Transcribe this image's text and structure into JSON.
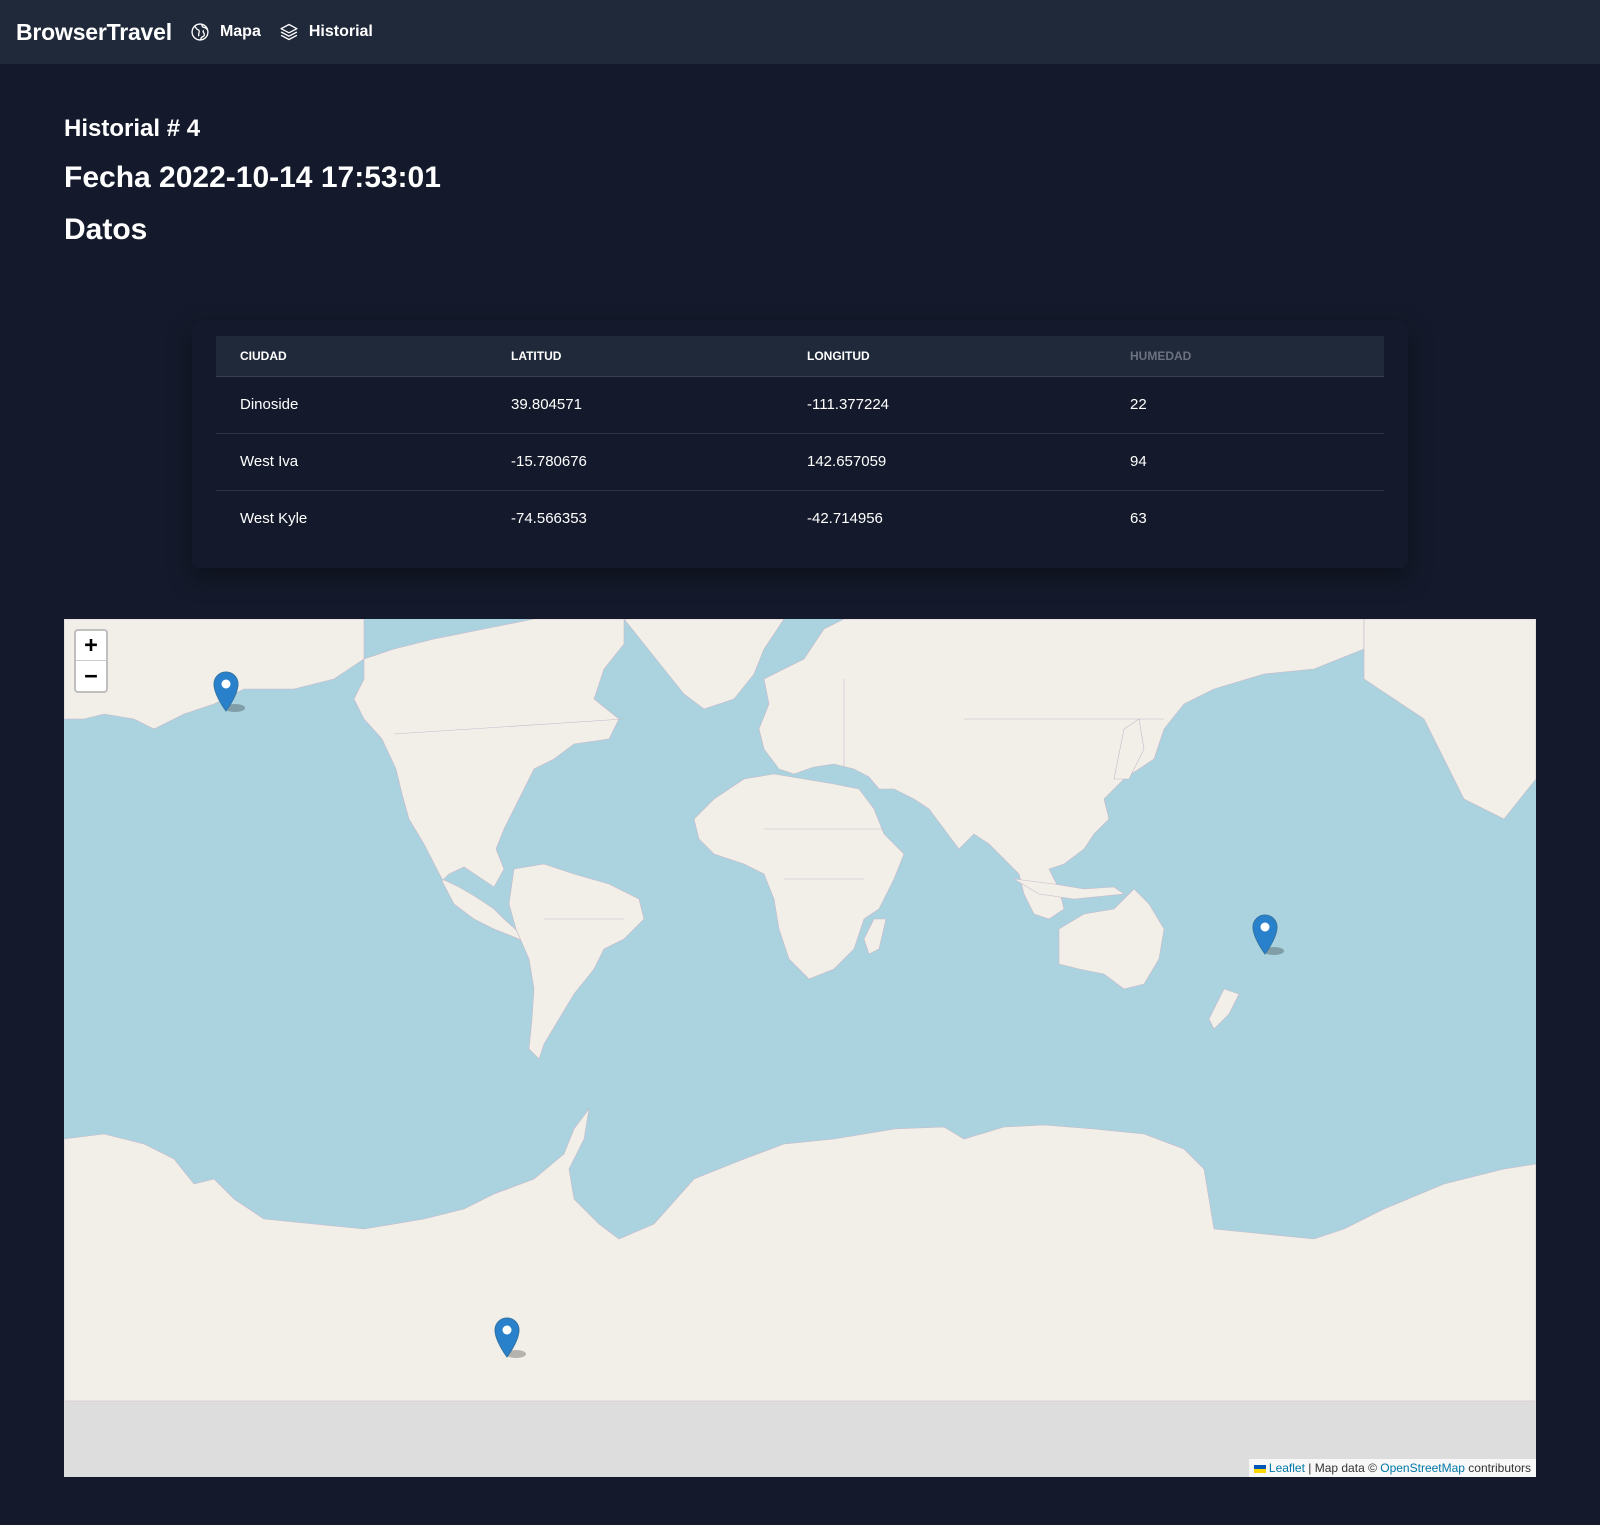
{
  "nav": {
    "brand": "BrowserTravel",
    "links": [
      {
        "label": "Mapa",
        "icon": "globe-icon"
      },
      {
        "label": "Historial",
        "icon": "layers-icon"
      }
    ]
  },
  "page": {
    "title": "Historial # 4",
    "fecha": "Fecha 2022-10-14 17:53:01",
    "datos": "Datos"
  },
  "table": {
    "headers": [
      "CIUDAD",
      "LATITUD",
      "LONGITUD",
      "HUMEDAD"
    ],
    "rows": [
      [
        "Dinoside",
        "39.804571",
        "-111.377224",
        "22"
      ],
      [
        "West Iva",
        "-15.780676",
        "142.657059",
        "94"
      ],
      [
        "West Kyle",
        "-74.566353",
        "-42.714956",
        "63"
      ]
    ]
  },
  "map": {
    "zoom_in": "+",
    "zoom_out": "−",
    "attribution": {
      "leaflet": "Leaflet",
      "sep": " | Map data © ",
      "osm": "OpenStreetMap",
      "contributors": " contributors"
    },
    "markers": [
      {
        "city": "Dinoside",
        "lat": 39.804571,
        "lon": -111.377224
      },
      {
        "city": "West Iva",
        "lat": -15.780676,
        "lon": 142.657059
      },
      {
        "city": "West Kyle",
        "lat": -74.566353,
        "lon": -42.714956
      }
    ],
    "colors": {
      "water": "#aad3df",
      "land": "#f2efe9",
      "void": "#dddddd",
      "marker": "#2a81cb"
    }
  }
}
